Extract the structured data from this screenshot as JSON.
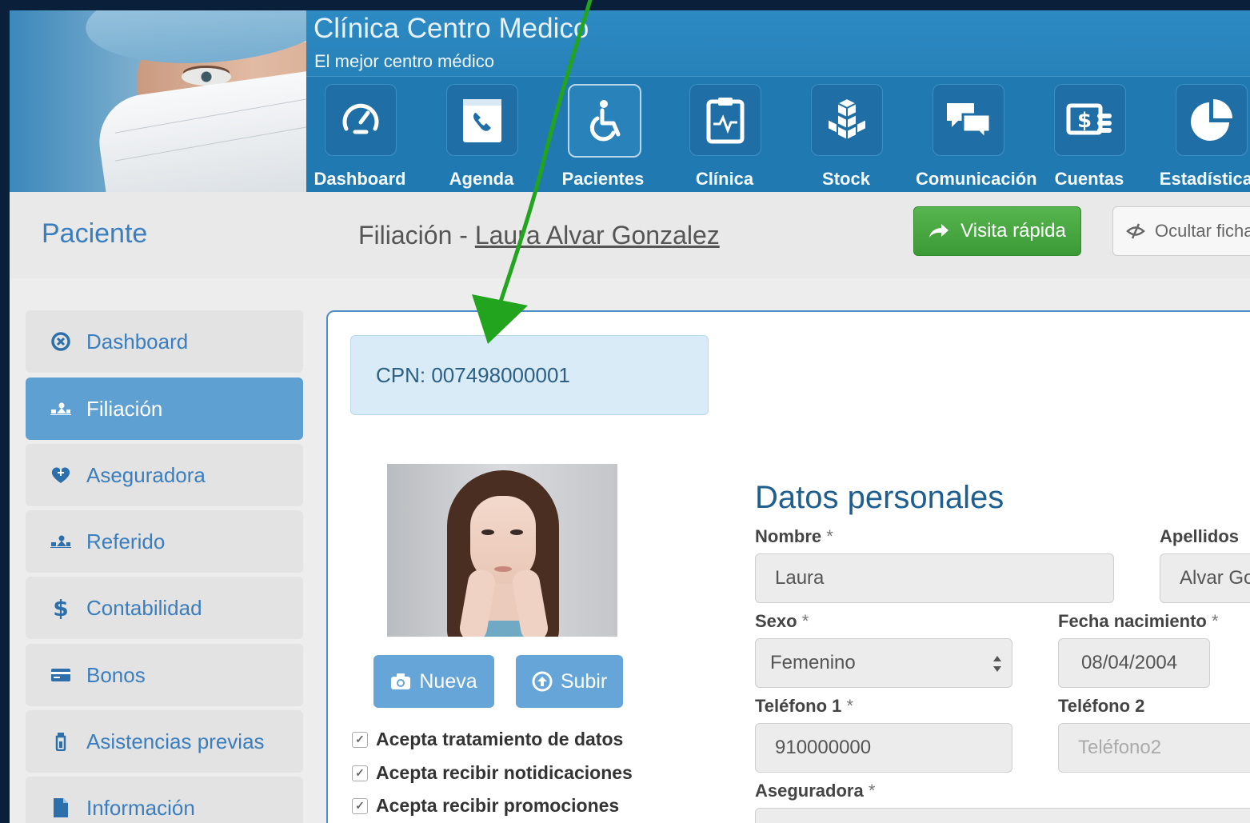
{
  "header": {
    "clinic_title": "Clínica Centro Medico",
    "clinic_subtitle": "El mejor centro médico"
  },
  "nav": {
    "items": [
      {
        "label": "Dashboard",
        "icon": "speedometer-icon"
      },
      {
        "label": "Agenda",
        "icon": "phonebook-icon"
      },
      {
        "label": "Pacientes",
        "icon": "wheelchair-icon",
        "active": true
      },
      {
        "label": "Clínica",
        "icon": "clipboard-pulse-icon"
      },
      {
        "label": "Stock",
        "icon": "boxes-icon"
      },
      {
        "label": "Comunicación",
        "icon": "chat-bubbles-icon"
      },
      {
        "label": "Cuentas",
        "icon": "money-icon"
      },
      {
        "label": "Estadísticas",
        "icon": "pie-chart-icon"
      }
    ]
  },
  "page": {
    "title": "Paciente",
    "filiacion_prefix": "Filiación - ",
    "patient_name": "Laura Alvar Gonzalez",
    "btn_visita": "Visita rápida",
    "btn_ocultar": "Ocultar ficha"
  },
  "sidebar": {
    "items": [
      {
        "label": "Dashboard",
        "icon": "circle-x-icon"
      },
      {
        "label": "Filiación",
        "icon": "group-icon",
        "active": true
      },
      {
        "label": "Aseguradora",
        "icon": "shield-heart-icon"
      },
      {
        "label": "Referido",
        "icon": "group-icon"
      },
      {
        "label": "Contabilidad",
        "icon": "dollar-icon"
      },
      {
        "label": "Bonos",
        "icon": "card-icon"
      },
      {
        "label": "Asistencias previas",
        "icon": "flask-icon"
      },
      {
        "label": "Información",
        "icon": "file-icon"
      }
    ]
  },
  "patient": {
    "cpn": "CPN: 007498000001",
    "btn_nueva": "Nueva",
    "btn_subir": "Subir",
    "checks": [
      "Acepta tratamiento de datos",
      "Acepta recibir notidicaciones",
      "Acepta recibir promociones"
    ]
  },
  "form": {
    "section_title": "Datos personales",
    "nombre_label": "Nombre",
    "nombre_value": "Laura",
    "apellidos_label": "Apellidos",
    "apellidos_value": "Alvar Gonzalez",
    "sexo_label": "Sexo",
    "sexo_value": "Femenino",
    "fecha_label": "Fecha nacimiento",
    "fecha_value": "08/04/2004",
    "tel1_label": "Teléfono 1",
    "tel1_value": "910000000",
    "tel2_label": "Teléfono 2",
    "tel2_placeholder": "Teléfono2",
    "aseguradora_label": "Aseguradora",
    "required_mark": "*"
  },
  "colors": {
    "accent_blue": "#3a7ebf",
    "header_blue": "#2179b2",
    "success_green": "#4aa843",
    "annotation_arrow": "#22a41e"
  }
}
